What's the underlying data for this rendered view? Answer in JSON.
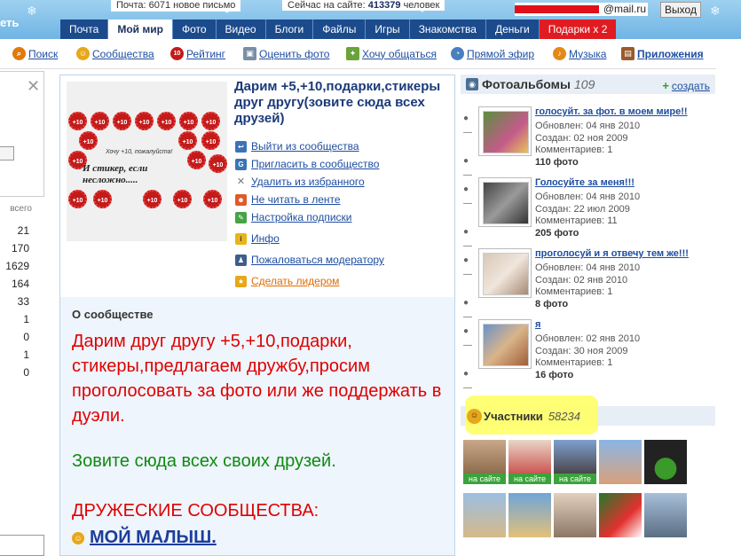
{
  "header": {
    "logo_fragment": "еть",
    "counter_text": "Почта: 6071 новое письмо",
    "online_label": "Сейчас на сайте:",
    "online_count": "413379",
    "online_suffix": "человек",
    "email_suffix": "@mail.ru",
    "exit_label": "Выход",
    "tabs": [
      "Почта",
      "Мой мир",
      "Фото",
      "Видео",
      "Блоги",
      "Файлы",
      "Игры",
      "Знакомства",
      "Деньги",
      "Подарки x 2"
    ]
  },
  "subnav": {
    "items": [
      "Поиск",
      "Сообщества",
      "Рейтинг",
      "Оценить фото",
      "Хочу общаться",
      "Прямой эфир",
      "Музыка",
      "Приложения"
    ]
  },
  "left": {
    "stats_header": "всего",
    "stats": [
      "21",
      "170",
      "1629",
      "164",
      "33",
      "1",
      "0",
      "1",
      "0"
    ]
  },
  "community": {
    "title": "Дарим +5,+10,подарки,стикеры друг другу(зовите сюда всех друзей)",
    "image_caption_small": "Хочу +10, пожалуйста!",
    "image_caption": "И стикер, если несложно.....",
    "badge_text": "+10",
    "actions": [
      "Выйти из сообщества",
      "Пригласить в сообщество",
      "Удалить из избранного",
      "Не читать в ленте",
      "Настройка подписки",
      "Инфо",
      "Пожаловаться модератору",
      "Сделать лидером"
    ],
    "about_title": "О сообществе",
    "about_text": "Дарим друг другу +5,+10,подарки, стикеры,предлагаем дружбу,просим проголосовать за фото или же поддержать в дуэли.",
    "invite_text": "Зовите сюда всех своих друзей.",
    "friends_title": "ДРУЖЕСКИЕ СООБЩЕСТВА:",
    "friends_link": "МОЙ МАЛЫШ."
  },
  "albums": {
    "title": "Фотоальбомы",
    "count": "109",
    "create_label": "создать",
    "items": [
      {
        "name": "голосуйт. за фот. в моем мире!!",
        "updated": "Обновлен: 04 янв 2010",
        "created": "Создан: 02 ноя 2009",
        "comments": "Комментариев: 1",
        "photos": "110 фото"
      },
      {
        "name": "Голосуйте за меня!!!",
        "updated": "Обновлен: 04 янв 2010",
        "created": "Создан: 22 июл 2009",
        "comments": "Комментариев: 11",
        "photos": "205 фото"
      },
      {
        "name": "проголосуй и я отвечу тем же!!!",
        "updated": "Обновлен: 04 янв 2010",
        "created": "Создан: 02 янв 2010",
        "comments": "Комментариев: 1",
        "photos": "8 фото"
      },
      {
        "name": "я",
        "updated": "Обновлен: 02 янв 2010",
        "created": "Создан: 30 ноя 2009",
        "comments": "Комментариев: 1",
        "photos": "16 фото"
      }
    ]
  },
  "members": {
    "title": "Участники",
    "count": "58234",
    "online_label": "на сайте"
  },
  "colors": {
    "nav_blue": "#1b4b8c",
    "gift_red": "#e11b22",
    "about_red": "#e00000",
    "about_green": "#108a10",
    "highlight": "#ffff66"
  }
}
